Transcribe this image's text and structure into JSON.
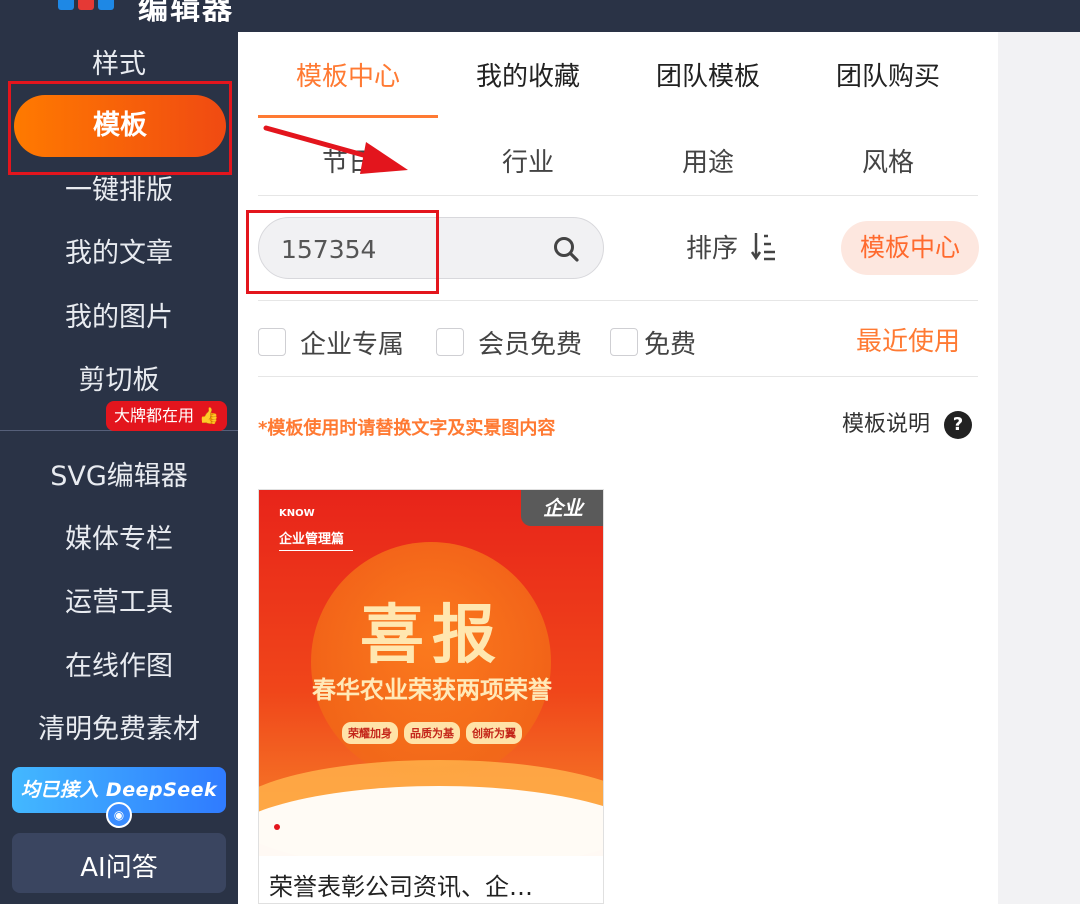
{
  "app": {
    "logo_text": "编辑器",
    "logo_colors": [
      "#1e88e5",
      "#e53935",
      "#1e88e5"
    ]
  },
  "sidebar": {
    "items": [
      {
        "label": "样式",
        "active": false
      },
      {
        "label": "模板",
        "active": true
      },
      {
        "label": "一键排版",
        "active": false
      },
      {
        "label": "我的文章",
        "active": false
      },
      {
        "label": "我的图片",
        "active": false
      },
      {
        "label": "剪切板",
        "active": false
      },
      {
        "label": "SVG编辑器",
        "active": false
      },
      {
        "label": "媒体专栏",
        "active": false
      },
      {
        "label": "运营工具",
        "active": false
      },
      {
        "label": "在线作图",
        "active": false
      },
      {
        "label": "清明免费素材",
        "active": false
      }
    ],
    "svg_badge": "大牌都在用 👍",
    "deepseek_banner": "均已接入 DeepSeek",
    "ai_button": "AI问答"
  },
  "tabs": [
    {
      "label": "模板中心",
      "active": true
    },
    {
      "label": "我的收藏",
      "active": false
    },
    {
      "label": "团队模板",
      "active": false
    },
    {
      "label": "团队购买",
      "active": false
    }
  ],
  "sub_tabs": [
    "节日",
    "行业",
    "用途",
    "风格"
  ],
  "search": {
    "value": "157354",
    "placeholder": ""
  },
  "sort": {
    "label": "排序"
  },
  "center_pill": "模板中心",
  "filters": [
    {
      "label": "企业专属",
      "checked": false
    },
    {
      "label": "会员免费",
      "checked": false
    },
    {
      "label": "免费",
      "checked": false
    }
  ],
  "recent": "最近使用",
  "notice": "*模板使用时请替换文字及实景图内容",
  "explain": "模板说明",
  "card": {
    "corner": "企业",
    "know": "KNOW",
    "subtitle": "企业管理篇",
    "headline": "喜报",
    "line": "春华农业荣获两项荣誉",
    "chips": [
      "荣耀加身",
      "品质为基",
      "创新为翼"
    ],
    "title": "荣誉表彰公司资讯、企…"
  },
  "colors": {
    "accent": "#ff7a33",
    "sidebar_bg": "#2a3346",
    "highlight_red": "#e3151d"
  }
}
